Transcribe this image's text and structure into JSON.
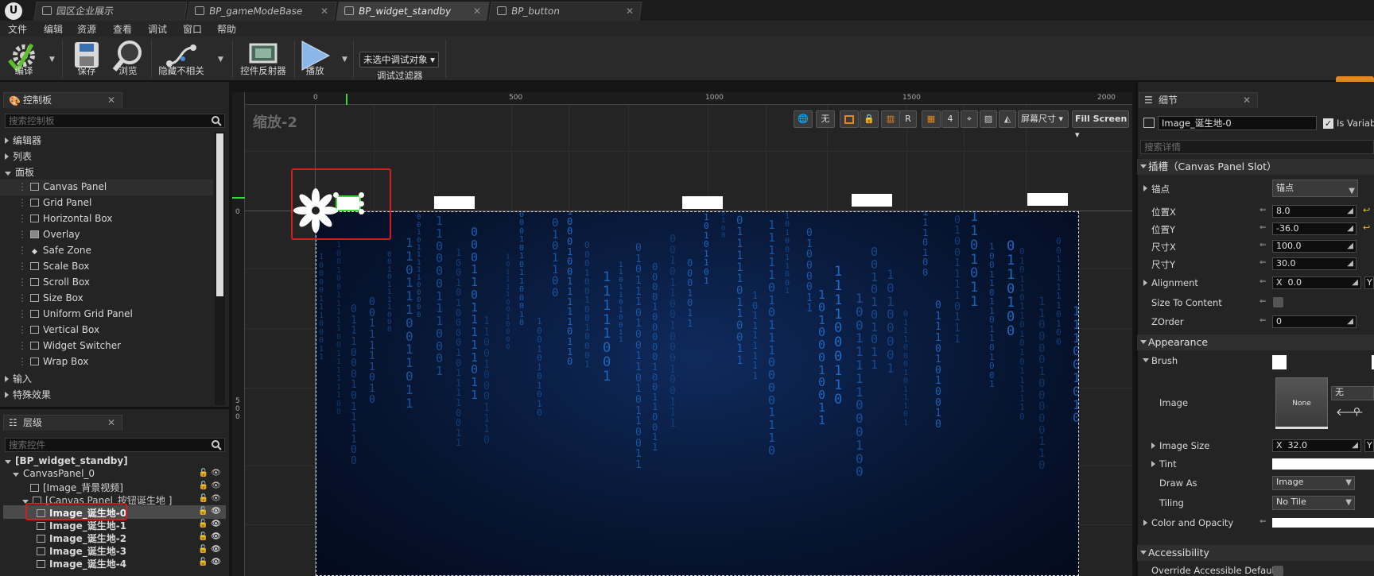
{
  "app": {
    "logo": "U"
  },
  "tabs": [
    {
      "label": "园区企业展示",
      "active": false
    },
    {
      "label": "BP_gameModeBase",
      "active": false
    },
    {
      "label": "BP_widget_standby",
      "active": true
    },
    {
      "label": "BP_button",
      "active": false
    }
  ],
  "menu": [
    "文件",
    "编辑",
    "资源",
    "查看",
    "调试",
    "窗口",
    "帮助"
  ],
  "toolbar": {
    "compile": "编译",
    "save": "保存",
    "browse": "浏览",
    "hide_unrelated": "隐藏不相关",
    "widget_reflector": "控件反射器",
    "play": "播放",
    "debug_select": "未选中调试对象",
    "debug_filter": "调试过滤器"
  },
  "palette": {
    "tab": "控制板",
    "search_placeholder": "搜索控制板",
    "categories": {
      "editor": "编辑器",
      "list": "列表",
      "panel": "面板",
      "input": "输入",
      "special": "特殊效果"
    },
    "panel_items": [
      "Canvas Panel",
      "Grid Panel",
      "Horizontal Box",
      "Overlay",
      "Safe Zone",
      "Scale Box",
      "Scroll Box",
      "Size Box",
      "Uniform Grid Panel",
      "Vertical Box",
      "Widget Switcher",
      "Wrap Box"
    ]
  },
  "hierarchy": {
    "tab": "层级",
    "search_placeholder": "搜索控件",
    "root": "[BP_widget_standby]",
    "canvas": "CanvasPanel_0",
    "bg_video": "[Image_背景视频]",
    "sub_canvas": "[Canvas Panel_按钮诞生地 ]",
    "images": [
      "Image_诞生地-0",
      "Image_诞生地-1",
      "Image_诞生地-2",
      "Image_诞生地-3",
      "Image_诞生地-4"
    ]
  },
  "designer": {
    "zoom": "缩放-2",
    "ruler_top": [
      "0",
      "500",
      "1000",
      "1500",
      "2000"
    ],
    "ruler_left_0": "0",
    "ruler_left_500": "500",
    "toolbar": {
      "none": "无",
      "r": "R",
      "four": "4",
      "screen_size": "屏幕尺寸",
      "fill_screen": "Fill Screen"
    },
    "matrix_digits": [
      "1",
      "0",
      "1",
      "0",
      "1",
      "1",
      "0",
      "0",
      "1",
      "0",
      "1",
      "0",
      "1",
      "1",
      "0",
      "1"
    ]
  },
  "details": {
    "tab": "细节",
    "name": "Image_诞生地-0",
    "is_variable": "Is Variab",
    "search_placeholder": "搜索详情",
    "slot_section": "插槽（Canvas Panel Slot）",
    "anchor_label": "锚点",
    "anchor_value": "锚点",
    "pos_x_label": "位置X",
    "pos_x": "8.0",
    "pos_y_label": "位置Y",
    "pos_y": "-36.0",
    "size_x_label": "尺寸X",
    "size_x": "100.0",
    "size_y_label": "尺寸Y",
    "size_y": "30.0",
    "alignment_label": "Alignment",
    "alignment_x_prefix": "X",
    "alignment_x": "0.0",
    "alignment_y_prefix": "Y",
    "size_to_content": "Size To Content",
    "zorder_label": "ZOrder",
    "zorder": "0",
    "appearance": "Appearance",
    "brush": "Brush",
    "image_label": "Image",
    "image_thumb": "None",
    "image_none": "无",
    "image_size_label": "Image Size",
    "image_size_x_prefix": "X",
    "image_size_x": "32.0",
    "image_size_y_prefix": "Y",
    "tint": "Tint",
    "draw_as_label": "Draw As",
    "draw_as": "Image",
    "tiling_label": "Tiling",
    "tiling": "No Tile",
    "color_opacity": "Color and Opacity",
    "accessibility": "Accessibility",
    "override_access": "Override Accessible Defaults"
  },
  "colors": {
    "selection_red": "#d11e1e",
    "accent_orange": "#e08a1e",
    "selected_row": "#4a4a4a",
    "matrix_blue": "#1e6cc8"
  }
}
